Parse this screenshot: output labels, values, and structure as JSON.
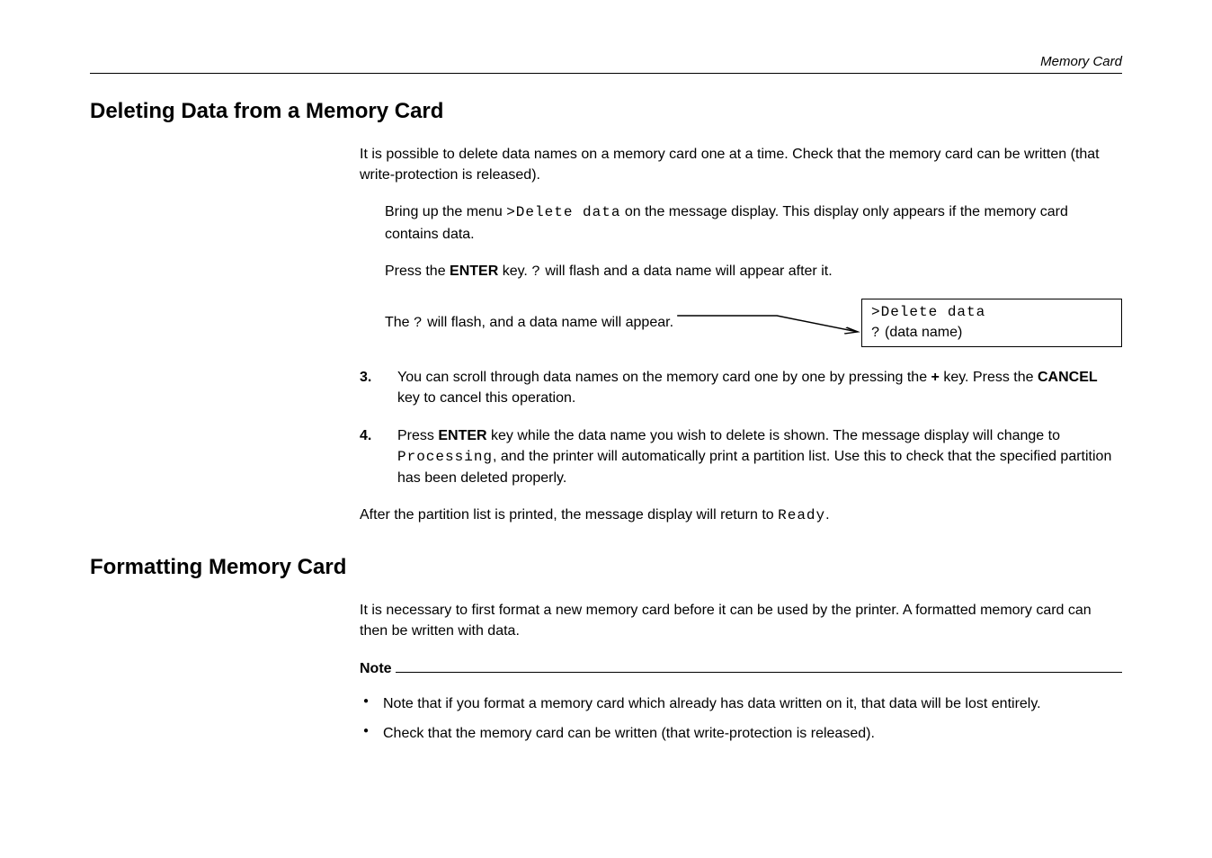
{
  "header": {
    "breadcrumb": "Memory Card"
  },
  "section1": {
    "title": "Deleting Data from a Memory Card",
    "intro": "It is possible to delete data names on a memory card one at a time.  Check that the memory card can  be written (that write-protection is released).",
    "step1_a": "Bring up the menu ",
    "step1_lcd": ">Delete data",
    "step1_b": " on the message display.  This display only appears if the memory card contains data.",
    "step2_a": "Press the ",
    "step2_key": "ENTER",
    "step2_b": " key. ",
    "step2_lcd": "?",
    "step2_c": " will flash and a data name will appear after it.",
    "callout_a": "The ",
    "callout_lcd": "?",
    "callout_b": " will flash, and a data name will appear.",
    "display_line1": ">Delete data",
    "display_line2_q": "?",
    "display_line2_rest": " (data name)",
    "item3_num": "3.",
    "item3_a": "You can scroll through data names on the memory card one by one by pressing the ",
    "item3_key": "+",
    "item3_b": " key.  Press the ",
    "item3_key2": "CANCEL",
    "item3_c": " key to cancel this operation.",
    "item4_num": "4.",
    "item4_a": "Press ",
    "item4_key": "ENTER",
    "item4_b": " key while the data name you wish to delete is shown.  The message display will change to ",
    "item4_lcd": "Processing",
    "item4_c": ", and the printer will automatically print a partition list.  Use this to check that the specified partition has been deleted properly.",
    "outro_a": "After the partition list is printed, the message display will return to ",
    "outro_lcd": "Ready",
    "outro_b": "."
  },
  "section2": {
    "title": "Formatting Memory Card",
    "intro": "It is necessary to first format a new memory card before it can be used by the printer.  A formatted memory card can then be written with data.",
    "note_label": "Note",
    "bullets": [
      "Note that if you format a memory card which already has data written on it, that data will be lost entirely.",
      "Check that the memory card can be written (that write-protection is released)."
    ]
  }
}
